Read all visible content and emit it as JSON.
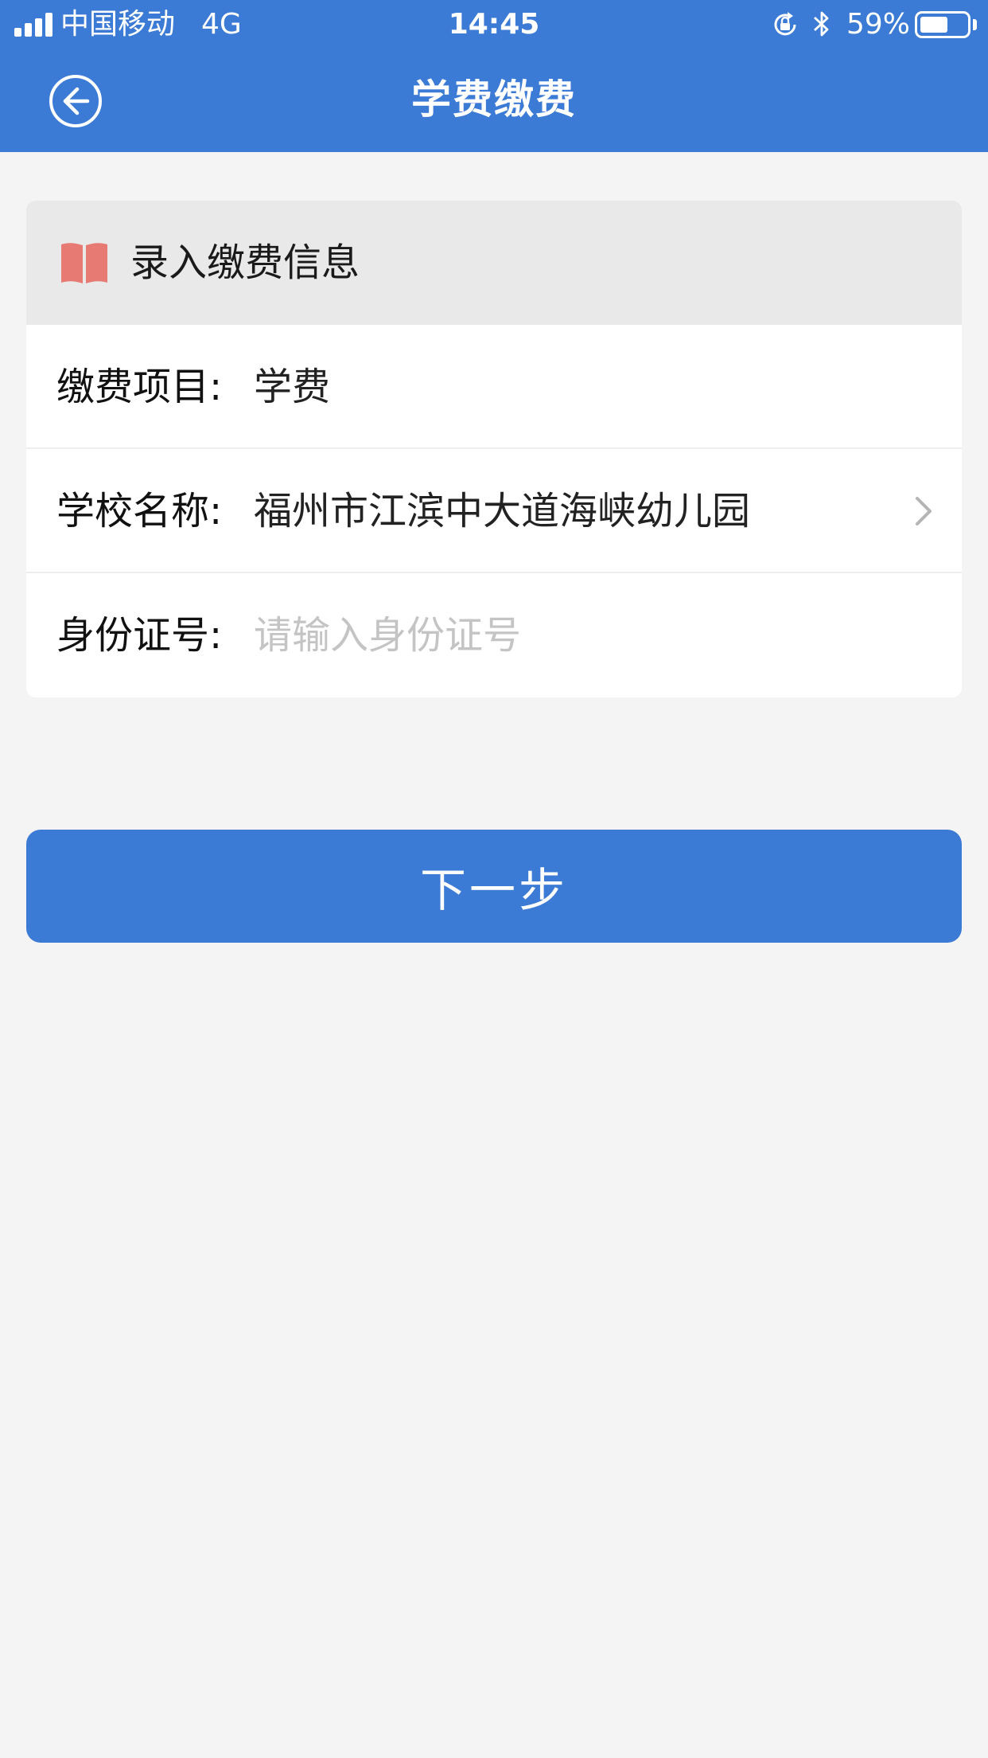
{
  "status_bar": {
    "carrier": "中国移动",
    "network": "4G",
    "time": "14:45",
    "battery_percent": "59%",
    "battery_level": 0.59,
    "icons": [
      "signal-icon",
      "rotation-lock-icon",
      "bluetooth-icon",
      "battery-icon"
    ]
  },
  "nav": {
    "title": "学费缴费",
    "back_icon": "back-arrow-circle-icon"
  },
  "form": {
    "header_icon": "book-icon",
    "header_title": "录入缴费信息",
    "rows": [
      {
        "label": "缴费项目:",
        "value": "学费"
      },
      {
        "label": "学校名称:",
        "value": "福州市江滨中大道海峡幼儿园",
        "icon": "chevron-right-icon"
      },
      {
        "label": "身份证号:",
        "value": "",
        "placeholder": "请输入身份证号"
      }
    ]
  },
  "actions": {
    "next_label": "下一步"
  },
  "colors": {
    "primary": "#3b7ad5",
    "background": "#f4f4f4",
    "card_header": "#e9e9e9",
    "book_icon": "#e77a72",
    "placeholder": "#c4c4c4"
  }
}
